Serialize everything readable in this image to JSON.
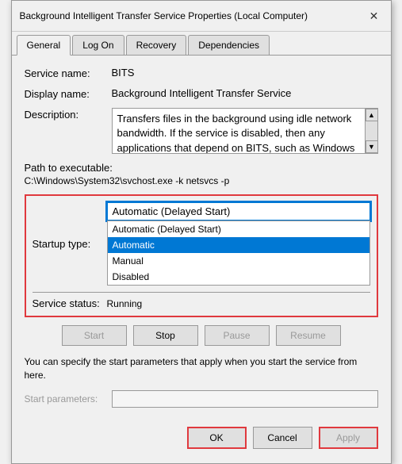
{
  "window": {
    "title": "Background Intelligent Transfer Service Properties (Local Computer)",
    "close_icon": "✕"
  },
  "tabs": [
    {
      "label": "General",
      "active": true
    },
    {
      "label": "Log On",
      "active": false
    },
    {
      "label": "Recovery",
      "active": false
    },
    {
      "label": "Dependencies",
      "active": false
    }
  ],
  "fields": {
    "service_name_label": "Service name:",
    "service_name_value": "BITS",
    "display_name_label": "Display name:",
    "display_name_value": "Background Intelligent Transfer Service",
    "description_label": "Description:",
    "description_text": "Transfers files in the background using idle network bandwidth. If the service is disabled, then any applications that depend on BITS, such as Windows",
    "path_label": "Path to executable:",
    "path_value": "C:\\Windows\\System32\\svchost.exe -k netsvcs -p"
  },
  "startup": {
    "label": "Startup type:",
    "selected_display": "Automatic (Delayed Start)",
    "options": [
      {
        "label": "Automatic (Delayed Start)",
        "selected": false
      },
      {
        "label": "Automatic",
        "selected": true
      },
      {
        "label": "Manual",
        "selected": false
      },
      {
        "label": "Disabled",
        "selected": false
      }
    ],
    "dropdown_arrow": "▼"
  },
  "service_status": {
    "label": "Service status:",
    "value": "Running"
  },
  "service_buttons": {
    "start": "Start",
    "stop": "Stop",
    "pause": "Pause",
    "resume": "Resume"
  },
  "info_text": "You can specify the start parameters that apply when you start the service from here.",
  "start_params": {
    "label": "Start parameters:",
    "placeholder": ""
  },
  "footer_buttons": {
    "ok": "OK",
    "cancel": "Cancel",
    "apply": "Apply"
  }
}
